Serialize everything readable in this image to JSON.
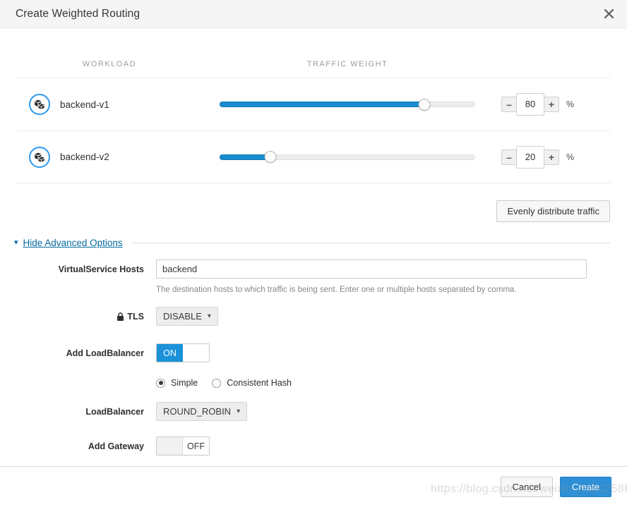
{
  "dialog": {
    "title": "Create Weighted Routing",
    "close_icon": "close-icon"
  },
  "table": {
    "columns": {
      "workload": "WORKLOAD",
      "traffic_weight": "TRAFFIC WEIGHT"
    },
    "rows": [
      {
        "icon": "workload-cube-icon",
        "name": "backend-v1",
        "weight": 80,
        "weight_display": "80",
        "unit": "%",
        "minus_label": "–",
        "plus_label": "+"
      },
      {
        "icon": "workload-cube-icon",
        "name": "backend-v2",
        "weight": 20,
        "weight_display": "20",
        "unit": "%",
        "minus_label": "–",
        "plus_label": "+"
      }
    ],
    "evenly_button": "Evenly distribute traffic"
  },
  "advanced": {
    "chevron_icon": "chevron-down-icon",
    "toggle_label": "Hide Advanced Options",
    "virtualservice_hosts": {
      "label": "VirtualService Hosts",
      "value": "backend",
      "placeholder": "",
      "help": "The destination hosts to which traffic is being sent. Enter one or multiple hosts separated by comma."
    },
    "tls": {
      "label": "TLS",
      "lock_icon": "lock-icon",
      "value": "DISABLE",
      "caret_icon": "chevron-down-icon"
    },
    "add_loadbalancer": {
      "label": "Add LoadBalancer",
      "state": "ON",
      "on_label": "ON"
    },
    "lb_mode": {
      "selected": "Simple",
      "options": [
        "Simple",
        "Consistent Hash"
      ]
    },
    "loadbalancer": {
      "label": "LoadBalancer",
      "value": "ROUND_ROBIN",
      "caret_icon": "chevron-down-icon"
    },
    "add_gateway": {
      "label": "Add Gateway",
      "state": "OFF",
      "off_label": "OFF"
    }
  },
  "footer": {
    "cancel": "Cancel",
    "create": "Create"
  },
  "watermark": {
    "text": "https://blog.csdn.net/weixin_43902588"
  },
  "colors": {
    "accent_blue": "#2b9af3",
    "slider_blue": "#1a8cd0",
    "toggle_on": "#1a91d8",
    "primary_button": "#2d8fd5",
    "link": "#06699e"
  }
}
